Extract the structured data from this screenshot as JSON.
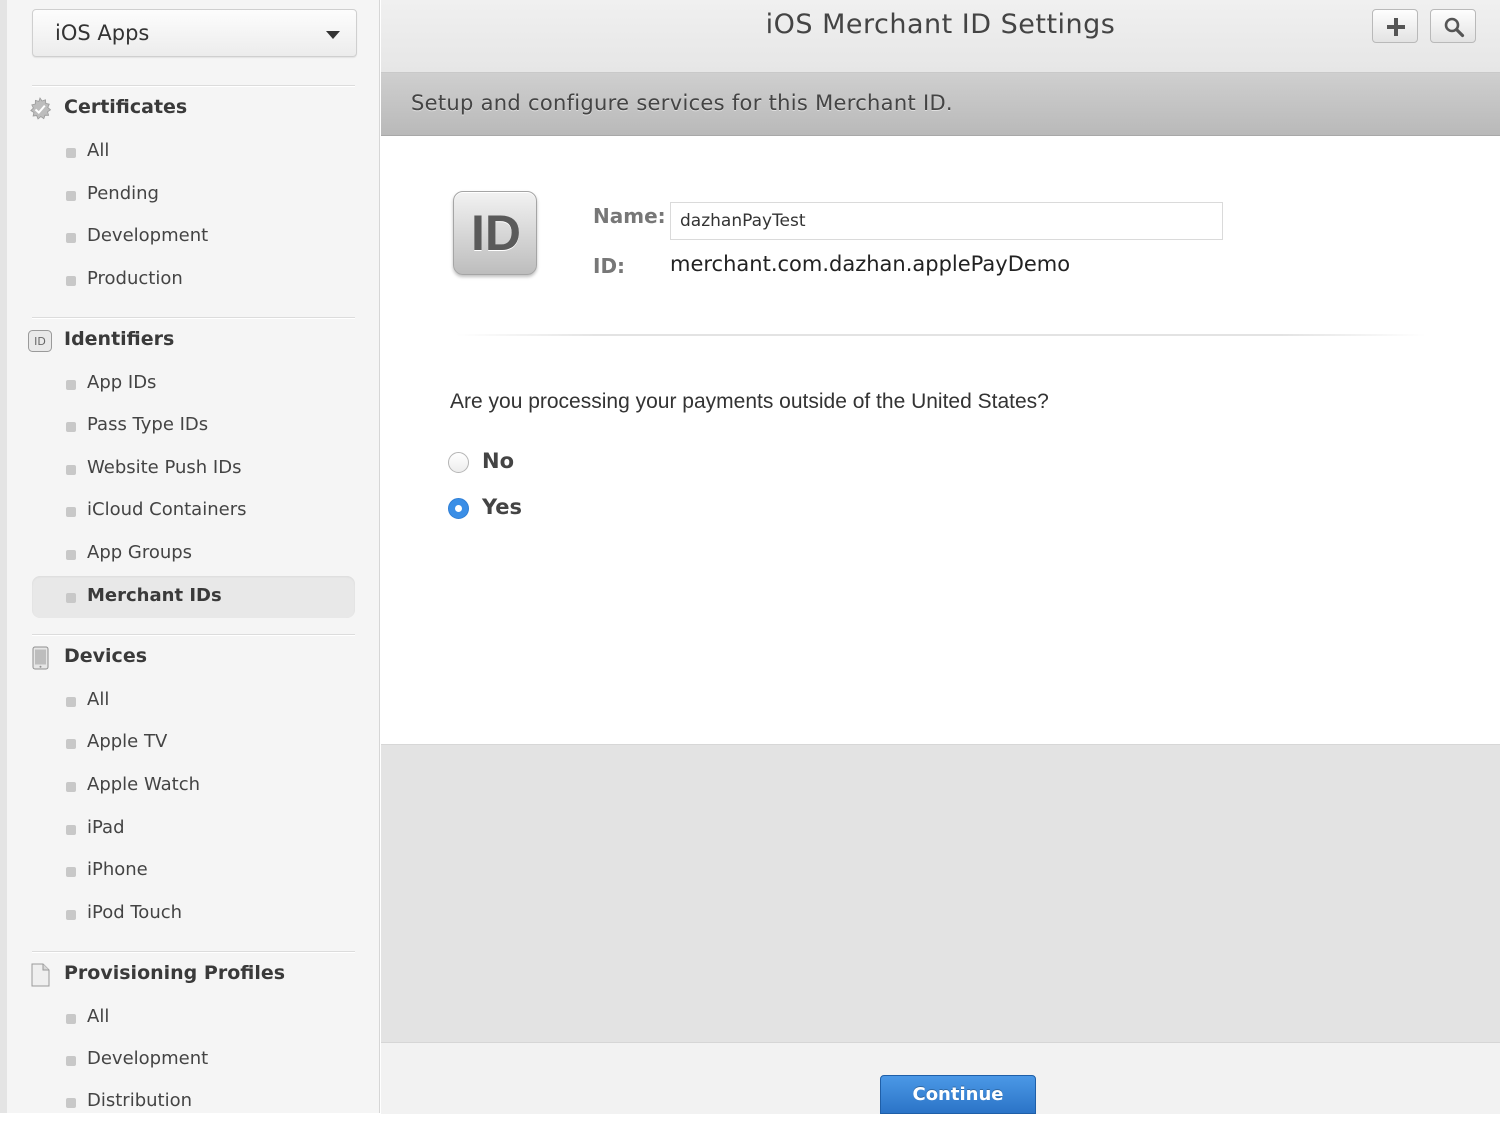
{
  "sidebar": {
    "platform": "iOS Apps",
    "sections": {
      "certificates": {
        "title": "Certificates",
        "items": [
          "All",
          "Pending",
          "Development",
          "Production"
        ]
      },
      "identifiers": {
        "title": "Identifiers",
        "icon_text": "ID",
        "items": [
          "App IDs",
          "Pass Type IDs",
          "Website Push IDs",
          "iCloud Containers",
          "App Groups",
          "Merchant IDs"
        ],
        "active": "Merchant IDs"
      },
      "devices": {
        "title": "Devices",
        "items": [
          "All",
          "Apple TV",
          "Apple Watch",
          "iPad",
          "iPhone",
          "iPod Touch"
        ]
      },
      "profiles": {
        "title": "Provisioning Profiles",
        "items": [
          "All",
          "Development",
          "Distribution"
        ]
      }
    }
  },
  "header": {
    "title": "iOS Merchant ID Settings",
    "subtitle": "Setup and configure services for this Merchant ID."
  },
  "merchant": {
    "badge": "ID",
    "name_label": "Name:",
    "name_value": "dazhanPayTest",
    "id_label": "ID:",
    "id_value": "merchant.com.dazhan.applePayDemo"
  },
  "question": {
    "text": "Are you processing your payments outside of the United States?",
    "options": [
      "No",
      "Yes"
    ],
    "selected": "Yes"
  },
  "footer": {
    "continue_label": "Continue"
  },
  "colors": {
    "accent": "#3a8ee6",
    "button": "#2b74c7"
  },
  "icons": {
    "add": "plus-icon",
    "search": "search-icon",
    "certificates": "gear-certificate-icon",
    "identifiers": "id-icon",
    "devices": "device-icon",
    "profiles": "document-icon"
  }
}
